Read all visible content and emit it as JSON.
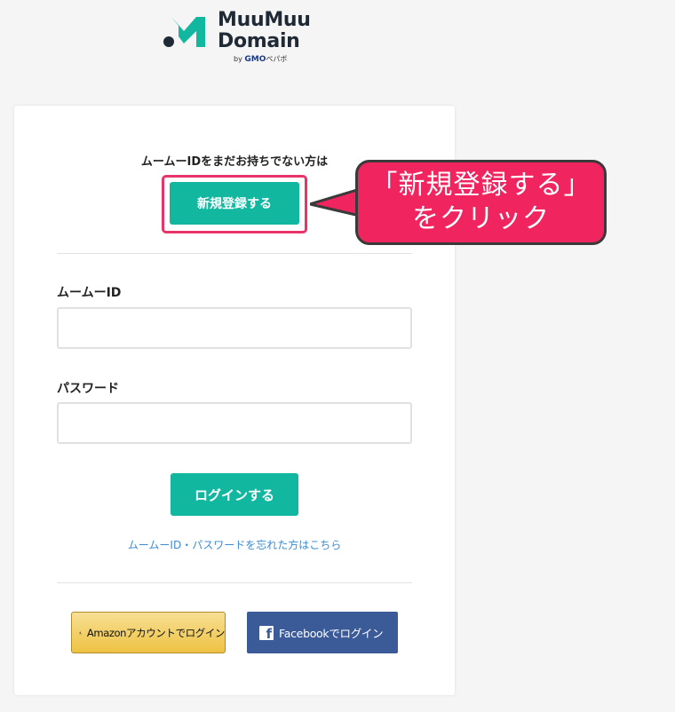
{
  "logo": {
    "line1": "MuuMuu",
    "line2": "Domain",
    "by": "by",
    "gmo": "GMO",
    "pepabo": "ペパボ",
    "colors": {
      "mark_teal": "#11b89f",
      "mark_dark": "#1f2a36"
    }
  },
  "signup": {
    "prompt": "ムームーIDをまだお持ちでない方は",
    "button_label": "新規登録する"
  },
  "login": {
    "id_label": "ムームーID",
    "id_value": "",
    "password_label": "パスワード",
    "password_value": "",
    "button_label": "ログインする",
    "forgot_link": "ムームーID・パスワードを忘れた方はこちら"
  },
  "social": {
    "amazon_label": "Amazonアカウントでログイン",
    "facebook_label": "Facebookでログイン"
  },
  "callout": {
    "line1": "「新規登録する」",
    "line2": "をクリック"
  },
  "colors": {
    "accent": "#11b89f",
    "highlight": "#e8336b",
    "callout_bg": "#f0245e",
    "link": "#3c8bd4",
    "facebook": "#3a5a98",
    "amazon": "#eec242"
  }
}
